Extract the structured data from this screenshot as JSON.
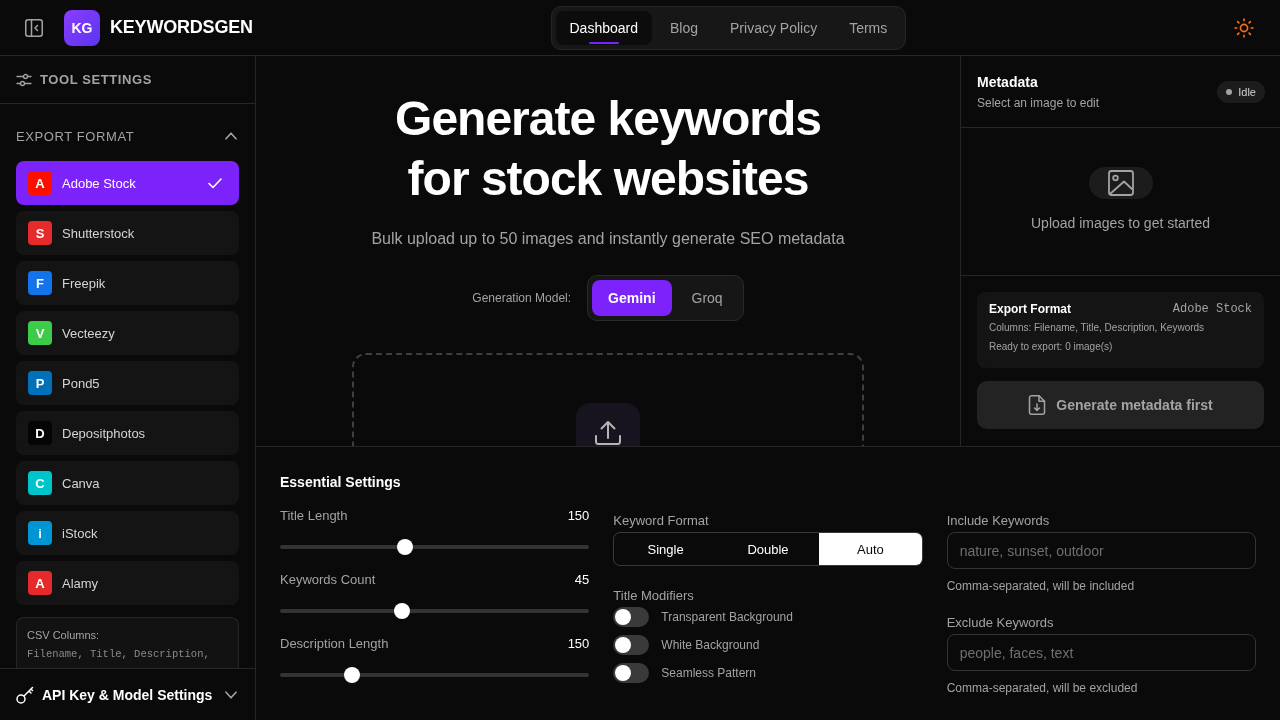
{
  "header": {
    "logo": "KG",
    "brand": "KEYWORDSGEN",
    "nav": [
      {
        "label": "Dashboard",
        "selected": true
      },
      {
        "label": "Blog",
        "selected": false
      },
      {
        "label": "Privacy Policy",
        "selected": false
      },
      {
        "label": "Terms",
        "selected": false
      }
    ]
  },
  "sidebar": {
    "title": "TOOL SETTINGS",
    "export_format": {
      "heading": "EXPORT FORMAT",
      "expanded": true,
      "items": [
        {
          "letter": "A",
          "label": "Adobe Stock",
          "color": "#fa0f00",
          "selected": true
        },
        {
          "letter": "S",
          "label": "Shutterstock",
          "color": "#e62b2b",
          "selected": false
        },
        {
          "letter": "F",
          "label": "Freepik",
          "color": "#1273eb",
          "selected": false
        },
        {
          "letter": "V",
          "label": "Vecteezy",
          "color": "#3dcc4a",
          "selected": false
        },
        {
          "letter": "P",
          "label": "Pond5",
          "color": "#0070b8",
          "selected": false
        },
        {
          "letter": "D",
          "label": "Depositphotos",
          "color": "#050505",
          "selected": false
        },
        {
          "letter": "C",
          "label": "Canva",
          "color": "#00c4cc",
          "selected": false
        },
        {
          "letter": "i",
          "label": "iStock",
          "color": "#0096d6",
          "selected": false
        },
        {
          "letter": "A",
          "label": "Alamy",
          "color": "#e42a2a",
          "selected": false
        }
      ]
    },
    "csv_columns": {
      "label": "CSV Columns:",
      "value": "Filename, Title, Description,"
    },
    "api_settings": {
      "label": "API Key & Model Settings",
      "expanded": false
    }
  },
  "hero": {
    "title_lines": [
      "Generate keywords",
      "for stock websites"
    ],
    "subtitle": "Bulk upload up to 50 images and instantly generate SEO metadata",
    "model": {
      "label": "Generation Model:",
      "options": [
        {
          "label": "Gemini",
          "selected": true
        },
        {
          "label": "Groq",
          "selected": false
        }
      ]
    }
  },
  "metadata_panel": {
    "title": "Metadata",
    "subtitle": "Select an image to edit",
    "status": "Idle",
    "empty_text": "Upload images to get started",
    "export": {
      "title": "Export Format",
      "format": "Adobe Stock",
      "columns": "Columns: Filename, Title, Description, Keywords",
      "ready": "Ready to export: 0 image(s)"
    },
    "button": {
      "label": "Generate metadata first",
      "disabled": true
    }
  },
  "essential_settings": {
    "title": "Essential Settings",
    "sliders": [
      {
        "label": "Title Length",
        "reading": "150",
        "level": 0.405
      },
      {
        "label": "Keywords Count",
        "reading": "45",
        "level": 0.395
      },
      {
        "label": "Description Length",
        "reading": "150",
        "level": 0.233
      }
    ],
    "keyword_format": {
      "label": "Keyword Format",
      "options": [
        {
          "label": "Single",
          "selected": false
        },
        {
          "label": "Double",
          "selected": false
        },
        {
          "label": "Auto",
          "selected": true
        }
      ]
    },
    "title_modifiers": {
      "label": "Title Modifiers",
      "items": [
        {
          "label": "Transparent Background",
          "on": false
        },
        {
          "label": "White Background",
          "on": false
        },
        {
          "label": "Seamless Pattern",
          "on": false
        }
      ]
    },
    "include": {
      "label": "Include Keywords",
      "placeholder": "nature, sunset, outdoor",
      "hint": "Comma-separated, will be included"
    },
    "exclude": {
      "label": "Exclude Keywords",
      "placeholder": "people, faces, text",
      "hint": "Comma-separated, will be excluded"
    }
  }
}
